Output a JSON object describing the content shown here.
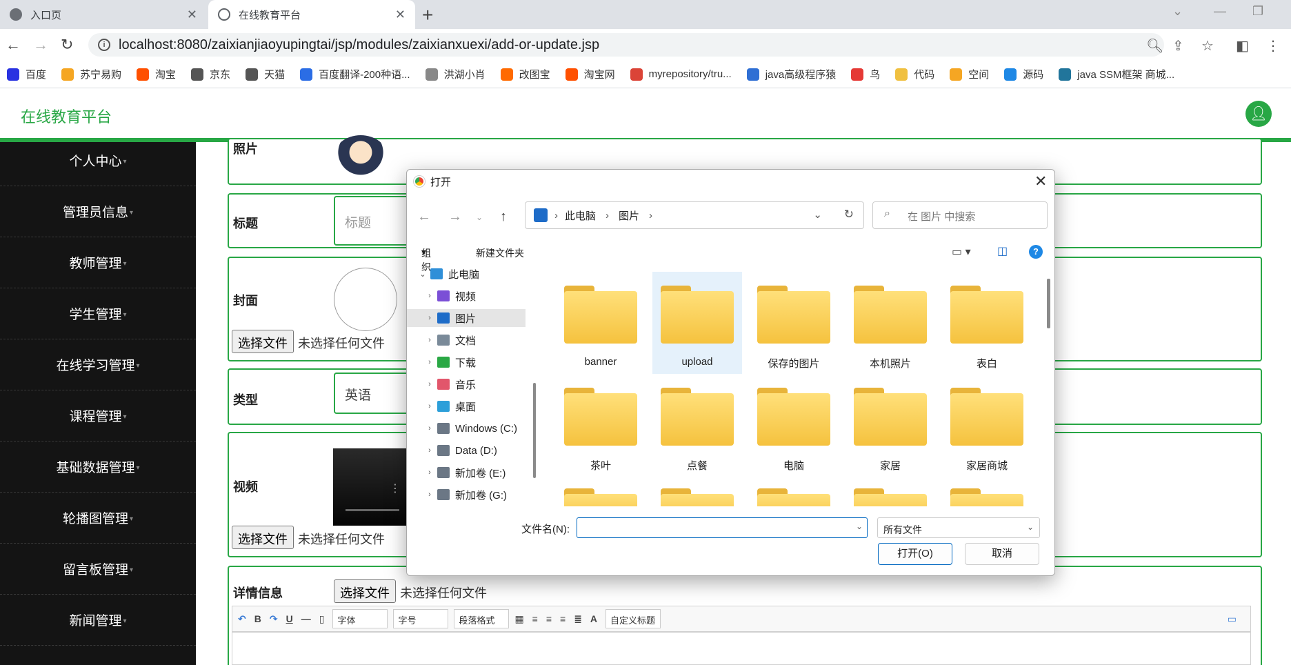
{
  "browser": {
    "tabs": [
      {
        "label": "入口页",
        "active": false
      },
      {
        "label": "在线教育平台",
        "active": true
      }
    ],
    "url": "localhost:8080/zaixianjiaoyupingtai/jsp/modules/zaixianxuexi/add-or-update.jsp",
    "bookmarks": [
      {
        "label": "百度",
        "color": "#2932e1"
      },
      {
        "label": "苏宁易购",
        "color": "#f5a623"
      },
      {
        "label": "淘宝",
        "color": "#ff5000"
      },
      {
        "label": "京东",
        "color": "#555555"
      },
      {
        "label": "天猫",
        "color": "#555555"
      },
      {
        "label": "百度翻译-200种语...",
        "color": "#2b6de5"
      },
      {
        "label": "洪湖小肖",
        "color": "#888888"
      },
      {
        "label": "改图宝",
        "color": "#ff6a00"
      },
      {
        "label": "淘宝网",
        "color": "#ff5000"
      },
      {
        "label": "myrepository/tru...",
        "color": "#db4437"
      },
      {
        "label": "java高级程序猿",
        "color": "#2f6fd4"
      },
      {
        "label": "鸟",
        "color": "#e53935"
      },
      {
        "label": "代码",
        "color": "#f0c040"
      },
      {
        "label": "空间",
        "color": "#f5a623"
      },
      {
        "label": "源码",
        "color": "#1e88e5"
      },
      {
        "label": "java SSM框架 商城...",
        "color": "#21759b"
      }
    ]
  },
  "app": {
    "title": "在线教育平台",
    "accent": "#28a745"
  },
  "sidebar": {
    "items": [
      {
        "label": "个人中心"
      },
      {
        "label": "管理员信息"
      },
      {
        "label": "教师管理"
      },
      {
        "label": "学生管理"
      },
      {
        "label": "在线学习管理"
      },
      {
        "label": "课程管理"
      },
      {
        "label": "基础数据管理"
      },
      {
        "label": "轮播图管理"
      },
      {
        "label": "留言板管理"
      },
      {
        "label": "新闻管理"
      }
    ]
  },
  "form": {
    "photo_label": "照片",
    "title_label": "标题",
    "title_placeholder": "标题",
    "cover_label": "封面",
    "choose_file": "选择文件",
    "no_file": "未选择任何文件",
    "type_label": "类型",
    "type_value": "英语",
    "video_label": "视频",
    "detail_label": "详情信息",
    "editor": {
      "font": "字体",
      "size": "字号",
      "para": "段落格式",
      "custom_title": "自定义标题"
    }
  },
  "dialog": {
    "title": "打开",
    "breadcrumb": [
      "此电脑",
      "图片"
    ],
    "search_placeholder": "在 图片 中搜索",
    "organize": "组织",
    "new_folder": "新建文件夹",
    "tree": [
      {
        "label": "此电脑",
        "level": 0,
        "color": "#2f8fd8"
      },
      {
        "label": "视频",
        "level": 1,
        "color": "#7b4fd6"
      },
      {
        "label": "图片",
        "level": 1,
        "color": "#1e6cc8",
        "selected": true
      },
      {
        "label": "文档",
        "level": 1,
        "color": "#7a8a99"
      },
      {
        "label": "下载",
        "level": 1,
        "color": "#2aa845"
      },
      {
        "label": "音乐",
        "level": 1,
        "color": "#e2566b"
      },
      {
        "label": "桌面",
        "level": 1,
        "color": "#2d9fd9"
      },
      {
        "label": "Windows (C:)",
        "level": 1,
        "color": "#6b7785"
      },
      {
        "label": "Data (D:)",
        "level": 1,
        "color": "#6b7785"
      },
      {
        "label": "新加卷 (E:)",
        "level": 1,
        "color": "#6b7785"
      },
      {
        "label": "新加卷 (G:)",
        "level": 1,
        "color": "#6b7785"
      }
    ],
    "folders": [
      "banner",
      "upload",
      "保存的图片",
      "本机照片",
      "表白",
      "茶叶",
      "点餐",
      "电脑",
      "家居",
      "家居商城"
    ],
    "filename_label": "文件名(N):",
    "filename_value": "",
    "filetype": "所有文件",
    "open": "打开(O)",
    "cancel": "取消"
  }
}
